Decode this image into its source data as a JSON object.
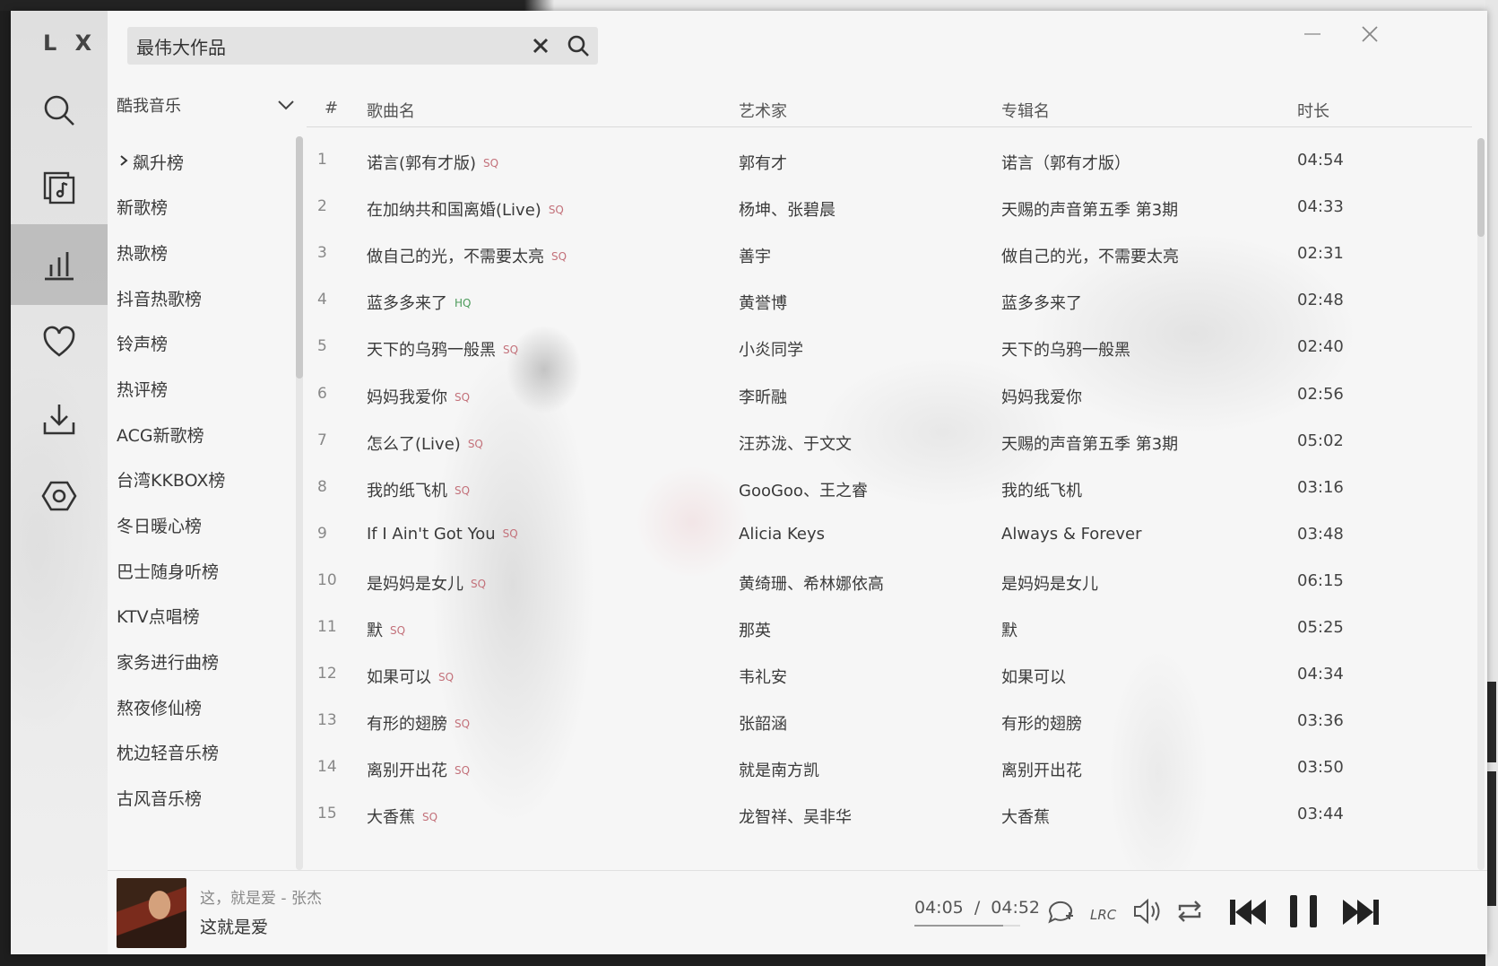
{
  "app": {
    "logo": "L X"
  },
  "search": {
    "value": "最伟大作品"
  },
  "source": {
    "selected": "酷我音乐"
  },
  "boards": [
    {
      "label": "飙升榜",
      "active": true
    },
    {
      "label": "新歌榜"
    },
    {
      "label": "热歌榜"
    },
    {
      "label": "抖音热歌榜"
    },
    {
      "label": "铃声榜"
    },
    {
      "label": "热评榜"
    },
    {
      "label": "ACG新歌榜"
    },
    {
      "label": "台湾KKBOX榜"
    },
    {
      "label": "冬日暖心榜"
    },
    {
      "label": "巴士随身听榜"
    },
    {
      "label": "KTV点唱榜"
    },
    {
      "label": "家务进行曲榜"
    },
    {
      "label": "熬夜修仙榜"
    },
    {
      "label": "枕边轻音乐榜"
    },
    {
      "label": "古风音乐榜"
    }
  ],
  "table": {
    "headers": {
      "num": "#",
      "name": "歌曲名",
      "artist": "艺术家",
      "album": "专辑名",
      "duration": "时长"
    },
    "rows": [
      {
        "num": "1",
        "name": "诺言(郭有才版)",
        "quality": "SQ",
        "artist": "郭有才",
        "album": "诺言（郭有才版）",
        "duration": "04:54"
      },
      {
        "num": "2",
        "name": "在加纳共和国离婚(Live)",
        "quality": "SQ",
        "artist": "杨坤、张碧晨",
        "album": "天赐的声音第五季 第3期",
        "duration": "04:33"
      },
      {
        "num": "3",
        "name": "做自己的光，不需要太亮",
        "quality": "SQ",
        "artist": "善宇",
        "album": "做自己的光，不需要太亮",
        "duration": "02:31"
      },
      {
        "num": "4",
        "name": "蓝多多来了",
        "quality": "HQ",
        "artist": "黄誉博",
        "album": "蓝多多来了",
        "duration": "02:48"
      },
      {
        "num": "5",
        "name": "天下的乌鸦一般黑",
        "quality": "SQ",
        "artist": "小炎同学",
        "album": "天下的乌鸦一般黑",
        "duration": "02:40"
      },
      {
        "num": "6",
        "name": "妈妈我爱你",
        "quality": "SQ",
        "artist": "李昕融",
        "album": "妈妈我爱你",
        "duration": "02:56"
      },
      {
        "num": "7",
        "name": "怎么了(Live)",
        "quality": "SQ",
        "artist": "汪苏泷、于文文",
        "album": "天赐的声音第五季 第3期",
        "duration": "05:02"
      },
      {
        "num": "8",
        "name": "我的纸飞机",
        "quality": "SQ",
        "artist": "GooGoo、王之睿",
        "album": "我的纸飞机",
        "duration": "03:16"
      },
      {
        "num": "9",
        "name": "If I Ain't Got You",
        "quality": "SQ",
        "artist": "Alicia Keys",
        "album": "Always & Forever",
        "duration": "03:48"
      },
      {
        "num": "10",
        "name": "是妈妈是女儿",
        "quality": "SQ",
        "artist": "黄绮珊、希林娜依高",
        "album": "是妈妈是女儿",
        "duration": "06:15"
      },
      {
        "num": "11",
        "name": "默",
        "quality": "SQ",
        "artist": "那英",
        "album": "默",
        "duration": "05:25"
      },
      {
        "num": "12",
        "name": "如果可以",
        "quality": "SQ",
        "artist": "韦礼安",
        "album": "如果可以",
        "duration": "04:34"
      },
      {
        "num": "13",
        "name": "有形的翅膀",
        "quality": "SQ",
        "artist": "张韶涵",
        "album": "有形的翅膀",
        "duration": "03:36"
      },
      {
        "num": "14",
        "name": "离别开出花",
        "quality": "SQ",
        "artist": "就是南方凯",
        "album": "离别开出花",
        "duration": "03:50"
      },
      {
        "num": "15",
        "name": "大香蕉",
        "quality": "SQ",
        "artist": "龙智祥、吴非华",
        "album": "大香蕉",
        "duration": "03:44"
      }
    ]
  },
  "player": {
    "subtitle": "这，就是爱 - 张杰",
    "title": "这就是爱",
    "current_time": "04:05",
    "separator": "/",
    "total_time": "04:52",
    "progress": 0.84
  },
  "colors": {
    "sq": "#c3717a",
    "hq": "#4c9b5b",
    "accent_bg": "#a0a0a0"
  }
}
